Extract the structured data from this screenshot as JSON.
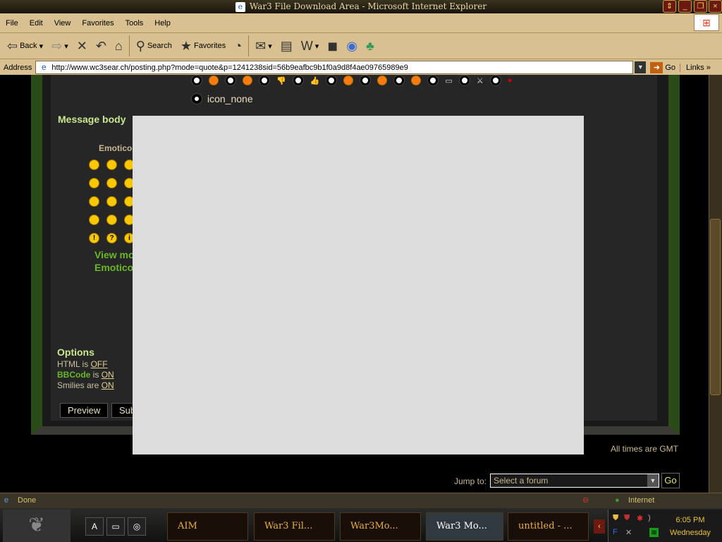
{
  "window": {
    "title": "War3 File Download Area - Microsoft Internet Explorer"
  },
  "menu": [
    "File",
    "Edit",
    "View",
    "Favorites",
    "Tools",
    "Help"
  ],
  "toolbar": {
    "back": "Back",
    "search": "Search",
    "favorites": "Favorites"
  },
  "address": {
    "label": "Address",
    "url": "http://www.wc3sear.ch/posting.php?mode=quote&p=1241238sid=56b9eafbc9b1f0a9d8f4ae09765989e9",
    "go": "Go",
    "links": "Links"
  },
  "post": {
    "icon_none": "icon_none",
    "message_body": "Message body",
    "emoticons": "Emoticons",
    "view_more_1": "View more",
    "view_more_2": "Emoticons",
    "options_title": "Options",
    "html_label": "HTML is ",
    "html_value": "OFF",
    "bbcode_label": "BBCode",
    "bbcode_is": " is ",
    "bbcode_value": "ON",
    "smilies_label": "Smilies are ",
    "smilies_value": "ON",
    "preview": "Preview",
    "submit": "Submit"
  },
  "footer": {
    "times": "All times are GMT",
    "jump_to": "Jump to:",
    "jump_select": "Select a forum",
    "jump_go": "Go"
  },
  "status": {
    "text": "Done",
    "zone": "Internet"
  },
  "taskbar": {
    "tasks": [
      "AIM",
      "War3 Fil...",
      "War3Mo...",
      "War3 Mo...",
      "untitled - ..."
    ],
    "time": "6:05 PM",
    "day": "Wednesday"
  }
}
